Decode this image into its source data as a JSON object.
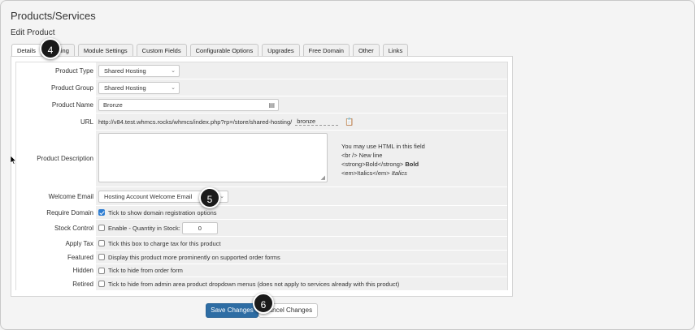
{
  "page": {
    "title": "Products/Services",
    "subtitle": "Edit Product"
  },
  "tabs": [
    {
      "label": "Details"
    },
    {
      "label": "Pricing"
    },
    {
      "label": "Module Settings"
    },
    {
      "label": "Custom Fields"
    },
    {
      "label": "Configurable Options"
    },
    {
      "label": "Upgrades"
    },
    {
      "label": "Free Domain"
    },
    {
      "label": "Other"
    },
    {
      "label": "Links"
    }
  ],
  "form": {
    "product_type": {
      "label": "Product Type",
      "value": "Shared Hosting"
    },
    "product_group": {
      "label": "Product Group",
      "value": "Shared Hosting"
    },
    "product_name": {
      "label": "Product Name",
      "value": "Bronze"
    },
    "url": {
      "label": "URL",
      "prefix": "http://v84.test.whmcs.rocks/whmcs/index.php?rp=/store/shared-hosting/",
      "slug": "bronze"
    },
    "description": {
      "label": "Product Description",
      "hint_line1": "You may use HTML in this field",
      "hint_line2": "<br /> New line",
      "hint_line3a": "<strong>Bold</strong> ",
      "hint_line3b": "Bold",
      "hint_line4a": "<em>Italics</em> ",
      "hint_line4b": "Italics"
    },
    "welcome_email": {
      "label": "Welcome Email",
      "value": "Hosting Account Welcome Email"
    },
    "require_domain": {
      "label": "Require Domain",
      "text": "Tick to show domain registration options",
      "checked": true
    },
    "stock_control": {
      "label": "Stock Control",
      "text": "Enable - Quantity in Stock:",
      "quantity": "0"
    },
    "apply_tax": {
      "label": "Apply Tax",
      "text": "Tick this box to charge tax for this product"
    },
    "featured": {
      "label": "Featured",
      "text": "Display this product more prominently on supported order forms"
    },
    "hidden": {
      "label": "Hidden",
      "text": "Tick to hide from order form"
    },
    "retired": {
      "label": "Retired",
      "text": "Tick to hide from admin area product dropdown menus (does not apply to services already with this product)"
    }
  },
  "buttons": {
    "save": "Save Changes",
    "cancel": "Cancel Changes"
  },
  "callouts": {
    "one": "4",
    "two": "5",
    "three": "6"
  },
  "colors": {
    "primary": "#2e6da4",
    "callout": "#1a1a1a"
  }
}
